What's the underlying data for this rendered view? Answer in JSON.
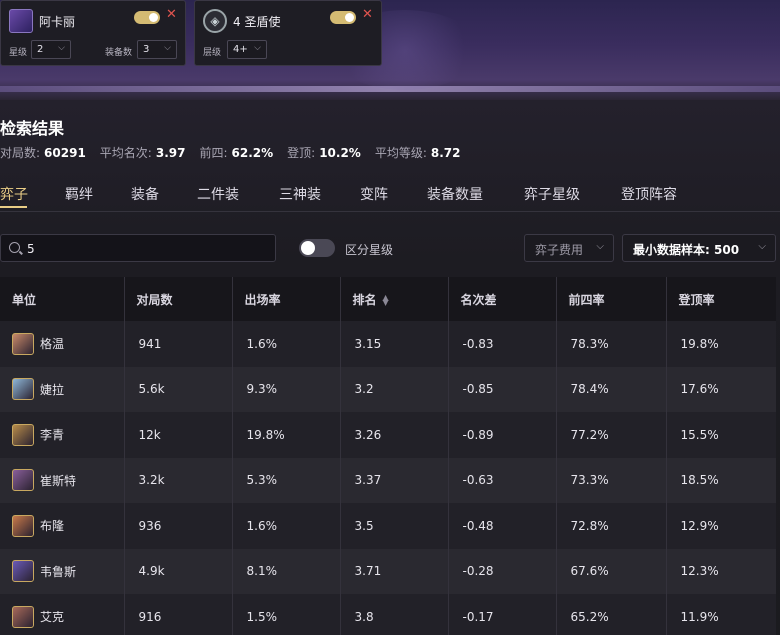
{
  "filters": [
    {
      "name": "阿卡丽",
      "icon": "akali-champion-icon",
      "fields": [
        {
          "label": "星级",
          "value": "2"
        },
        {
          "label": "装备数",
          "value": "3"
        }
      ]
    },
    {
      "name": "4 圣盾使",
      "icon": "aegis-trait-icon",
      "fields": [
        {
          "label": "层级",
          "value": "4+"
        }
      ]
    }
  ],
  "results": {
    "title": "检索结果",
    "stats": [
      {
        "label": "对局数:",
        "value": "60291"
      },
      {
        "label": "平均名次:",
        "value": "3.97"
      },
      {
        "label": "前四:",
        "value": "62.2%"
      },
      {
        "label": "登顶:",
        "value": "10.2%"
      },
      {
        "label": "平均等级:",
        "value": "8.72"
      }
    ]
  },
  "tabs": [
    "弈子",
    "羁绊",
    "装备",
    "二件装",
    "三神装",
    "变阵",
    "装备数量",
    "弈子星级",
    "登顶阵容"
  ],
  "controls": {
    "search_value": "5",
    "toggle_label": "区分星级",
    "cost_select": "弈子费用",
    "min_sample_label": "最小数据样本:",
    "min_sample_value": "500"
  },
  "table": {
    "headers": [
      "单位",
      "对局数",
      "出场率",
      "排名",
      "名次差",
      "前四率",
      "登顶率"
    ],
    "rows": [
      {
        "unit": "格温",
        "games": "941",
        "pick": "1.6%",
        "rank": "3.15",
        "diff": "-0.83",
        "top4": "78.3%",
        "top1": "19.8%",
        "color": "#c98a6a"
      },
      {
        "unit": "婕拉",
        "games": "5.6k",
        "pick": "9.3%",
        "rank": "3.2",
        "diff": "-0.85",
        "top4": "78.4%",
        "top1": "17.6%",
        "color": "#8fb7d8"
      },
      {
        "unit": "李青",
        "games": "12k",
        "pick": "19.8%",
        "rank": "3.26",
        "diff": "-0.89",
        "top4": "77.2%",
        "top1": "15.5%",
        "color": "#b88c4a"
      },
      {
        "unit": "崔斯特",
        "games": "3.2k",
        "pick": "5.3%",
        "rank": "3.37",
        "diff": "-0.63",
        "top4": "73.3%",
        "top1": "18.5%",
        "color": "#8a5f9a"
      },
      {
        "unit": "布隆",
        "games": "936",
        "pick": "1.6%",
        "rank": "3.5",
        "diff": "-0.48",
        "top4": "72.8%",
        "top1": "12.9%",
        "color": "#c97a4a"
      },
      {
        "unit": "韦鲁斯",
        "games": "4.9k",
        "pick": "8.1%",
        "rank": "3.71",
        "diff": "-0.28",
        "top4": "67.6%",
        "top1": "12.3%",
        "color": "#6a5ab8"
      },
      {
        "unit": "艾克",
        "games": "916",
        "pick": "1.5%",
        "rank": "3.8",
        "diff": "-0.17",
        "top4": "65.2%",
        "top1": "11.9%",
        "color": "#a86a5a"
      }
    ]
  }
}
